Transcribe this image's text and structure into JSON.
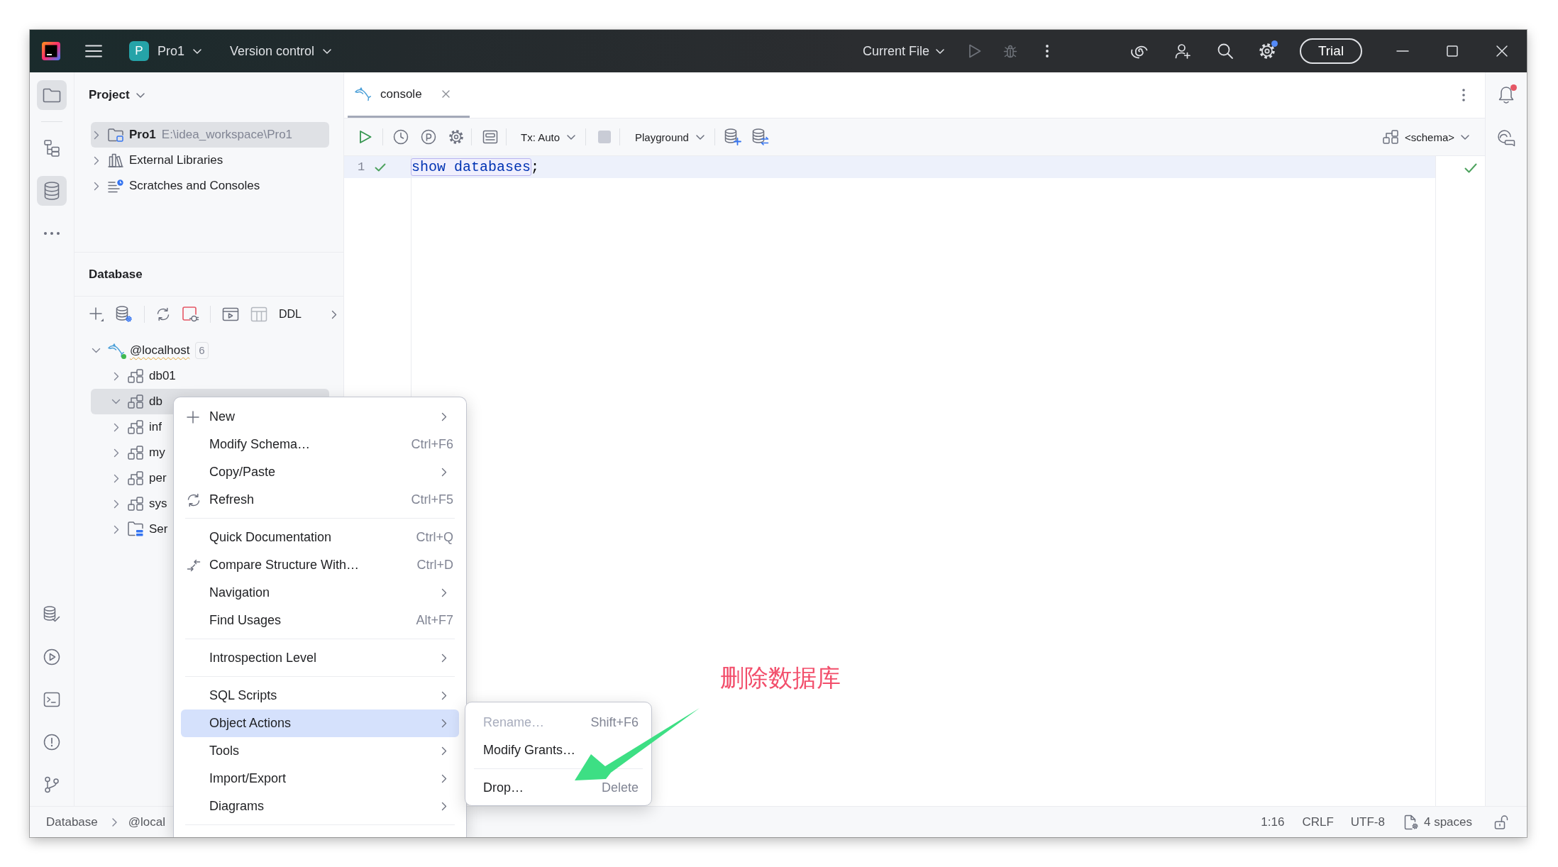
{
  "title_bar": {
    "project_badge": "P",
    "project": "Pro1",
    "vcs": "Version control",
    "run_config": "Current File",
    "run_disabled": true,
    "settings_badge": true,
    "trial": "Trial"
  },
  "tool_strip": {
    "top": [
      {
        "kind": "project",
        "selected": true
      },
      {
        "kind": "separator"
      },
      {
        "kind": "structure",
        "selected": false
      },
      {
        "kind": "database",
        "selected": true
      },
      {
        "kind": "more",
        "selected": false
      }
    ],
    "bottom": [
      {
        "kind": "services",
        "selected": false
      },
      {
        "kind": "run",
        "selected": false
      },
      {
        "kind": "terminal",
        "selected": false
      },
      {
        "kind": "problems",
        "selected": false
      },
      {
        "kind": "git",
        "selected": false
      }
    ]
  },
  "project_panel": {
    "title": "Project",
    "tree": [
      {
        "kind": "module",
        "label": "Pro1",
        "path": "E:\\idea_workspace\\Pro1",
        "expanded": false,
        "selected": true
      },
      {
        "kind": "libraries",
        "label": "External Libraries",
        "expanded": false,
        "selected": false
      },
      {
        "kind": "scratches",
        "label": "Scratches and Consoles",
        "expanded": false,
        "selected": false
      }
    ]
  },
  "database_panel": {
    "title": "Database",
    "ddl": "DDL",
    "tree": [
      {
        "kind": "connection",
        "label": "@localhost",
        "count": "6",
        "connected": true,
        "warning": true,
        "expanded": true,
        "selected": false,
        "children": [
          {
            "kind": "schema",
            "label": "db01",
            "expanded": false,
            "selected": false
          },
          {
            "kind": "schema",
            "label": "db",
            "expanded": true,
            "selected": true
          },
          {
            "kind": "schema",
            "label": "inf",
            "expanded": false,
            "selected": false
          },
          {
            "kind": "schema",
            "label": "my",
            "expanded": false,
            "selected": false
          },
          {
            "kind": "schema",
            "label": "per",
            "expanded": false,
            "selected": false
          },
          {
            "kind": "schema",
            "label": "sys",
            "expanded": false,
            "selected": false
          },
          {
            "kind": "server_objects",
            "label": "Ser",
            "expanded": false,
            "selected": false
          }
        ]
      }
    ]
  },
  "editor": {
    "tabs": [
      {
        "label": "console",
        "selected": true
      }
    ],
    "toolbar": {
      "run_enabled": true,
      "tx": "Tx: Auto",
      "stop_enabled": false,
      "mode": "Playground",
      "schema": "<schema>"
    },
    "lines": [
      {
        "number": "1",
        "ok": true,
        "current": true,
        "tokens": [
          {
            "kind": "keyword",
            "text": "show databases",
            "highlighted": true
          },
          {
            "kind": "plain",
            "text": ";",
            "highlighted": false
          }
        ]
      }
    ],
    "inspection_ok": true
  },
  "right_strip": {
    "notifications_unread": true
  },
  "status_bar": {
    "breadcrumbs": [
      "Database",
      "@local"
    ],
    "position": "1:16",
    "line_separator": "CRLF",
    "encoding": "UTF-8",
    "indent": "4 spaces",
    "locked": false
  },
  "context_menu": {
    "items": [
      {
        "kind": "add",
        "label": "New",
        "submenu": true,
        "selected": false
      },
      {
        "kind": "plain",
        "label": "Modify Schema…",
        "shortcut": "Ctrl+F6",
        "submenu": false,
        "selected": false
      },
      {
        "kind": "plain",
        "label": "Copy/Paste",
        "submenu": true,
        "selected": false
      },
      {
        "kind": "refresh",
        "label": "Refresh",
        "shortcut": "Ctrl+F5",
        "submenu": false,
        "selected": false
      },
      {
        "kind": "separator"
      },
      {
        "kind": "plain",
        "label": "Quick Documentation",
        "shortcut": "Ctrl+Q",
        "submenu": false,
        "selected": false
      },
      {
        "kind": "compare",
        "label": "Compare Structure With…",
        "shortcut": "Ctrl+D",
        "submenu": false,
        "selected": false
      },
      {
        "kind": "plain",
        "label": "Navigation",
        "submenu": true,
        "selected": false
      },
      {
        "kind": "plain",
        "label": "Find Usages",
        "shortcut": "Alt+F7",
        "submenu": false,
        "selected": false
      },
      {
        "kind": "separator"
      },
      {
        "kind": "plain",
        "label": "Introspection Level",
        "submenu": true,
        "selected": false
      },
      {
        "kind": "separator"
      },
      {
        "kind": "plain",
        "label": "SQL Scripts",
        "submenu": true,
        "selected": false
      },
      {
        "kind": "plain",
        "label": "Object Actions",
        "submenu": true,
        "selected": true
      },
      {
        "kind": "plain",
        "label": "Tools",
        "submenu": true,
        "selected": false
      },
      {
        "kind": "plain",
        "label": "Import/Export",
        "submenu": true,
        "selected": false
      },
      {
        "kind": "plain",
        "label": "Diagrams",
        "submenu": true,
        "selected": false
      },
      {
        "kind": "separator"
      }
    ]
  },
  "submenu": {
    "items": [
      {
        "kind": "plain",
        "label": "Rename…",
        "shortcut": "Shift+F6",
        "disabled": true,
        "selected": false
      },
      {
        "kind": "plain",
        "label": "Modify Grants…",
        "disabled": false,
        "selected": false
      },
      {
        "kind": "separator"
      },
      {
        "kind": "plain",
        "label": "Drop…",
        "shortcut": "Delete",
        "disabled": false,
        "selected": false
      }
    ]
  },
  "annotation": {
    "text": "删除数据库"
  }
}
